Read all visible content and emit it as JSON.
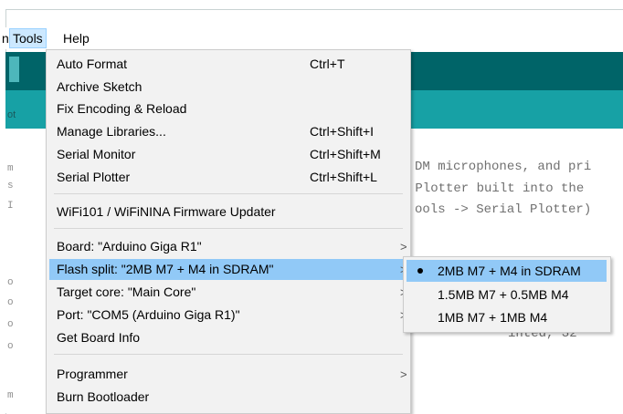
{
  "menubar": {
    "file_tail": "n",
    "tools": "Tools",
    "help": "Help"
  },
  "editor": {
    "tab_stub": "ot",
    "gutter": [
      "m",
      "s",
      "I",
      "o",
      "o",
      "o",
      "o",
      "m"
    ],
    "lines": [
      "DM microphones, and pri",
      " Plotter built into the",
      "ools -> Serial Plotter)"
    ],
    "partial_line": "inted, 32"
  },
  "tools_menu": {
    "items": [
      {
        "label": "Auto Format",
        "shortcut": "Ctrl+T"
      },
      {
        "label": "Archive Sketch",
        "shortcut": ""
      },
      {
        "label": "Fix Encoding & Reload",
        "shortcut": ""
      },
      {
        "label": "Manage Libraries...",
        "shortcut": "Ctrl+Shift+I"
      },
      {
        "label": "Serial Monitor",
        "shortcut": "Ctrl+Shift+M"
      },
      {
        "label": "Serial Plotter",
        "shortcut": "Ctrl+Shift+L"
      },
      {
        "label": "WiFi101 / WiFiNINA Firmware Updater",
        "shortcut": ""
      },
      {
        "label": "Board: \"Arduino Giga R1\"",
        "shortcut": ""
      },
      {
        "label": "Flash split: \"2MB M7 + M4 in SDRAM\"",
        "shortcut": ""
      },
      {
        "label": "Target core: \"Main Core\"",
        "shortcut": ""
      },
      {
        "label": "Port: \"COM5 (Arduino Giga R1)\"",
        "shortcut": ""
      },
      {
        "label": "Get Board Info",
        "shortcut": ""
      },
      {
        "label": "Programmer",
        "shortcut": ""
      },
      {
        "label": "Burn Bootloader",
        "shortcut": ""
      }
    ],
    "arrow": ">"
  },
  "flash_submenu": {
    "options": [
      {
        "label": "2MB M7 + M4 in SDRAM",
        "selected": true
      },
      {
        "label": "1.5MB M7 + 0.5MB M4",
        "selected": false
      },
      {
        "label": "1MB M7 + 1MB M4",
        "selected": false
      }
    ]
  },
  "colors": {
    "toolbar": "#006468",
    "tabs": "#17a1a5",
    "highlight": "#91c9f7",
    "menu_bg": "#f2f2f2"
  }
}
